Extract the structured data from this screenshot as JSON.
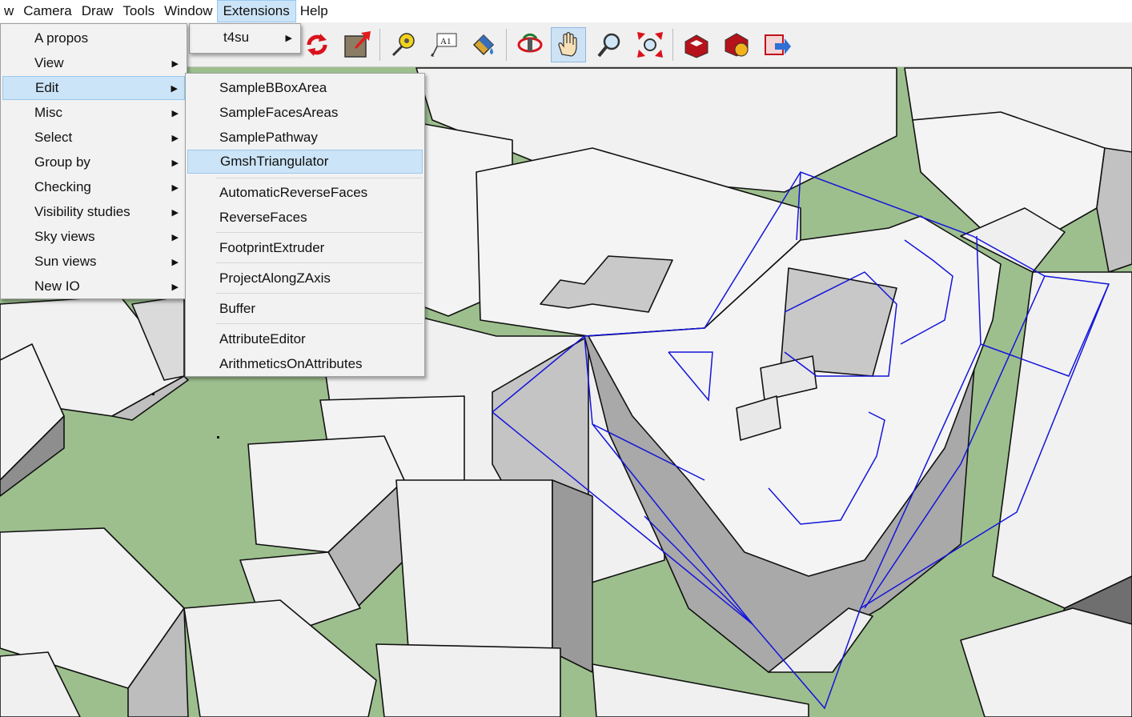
{
  "menubar": {
    "items": [
      "w",
      "Camera",
      "Draw",
      "Tools",
      "Window",
      "Extensions",
      "Help"
    ],
    "active": "Extensions"
  },
  "extensions_menu": {
    "items": [
      {
        "label": "t4su",
        "has_submenu": true
      }
    ]
  },
  "t4su_menu": {
    "items": [
      {
        "label": "A propos",
        "has_submenu": false
      },
      {
        "label": "View",
        "has_submenu": true
      },
      {
        "label": "Edit",
        "has_submenu": true,
        "highlighted": true
      },
      {
        "label": "Misc",
        "has_submenu": true
      },
      {
        "label": "Select",
        "has_submenu": true
      },
      {
        "label": "Group by",
        "has_submenu": true
      },
      {
        "label": "Checking",
        "has_submenu": true
      },
      {
        "label": "Visibility studies",
        "has_submenu": true
      },
      {
        "label": "Sky views",
        "has_submenu": true
      },
      {
        "label": "Sun views",
        "has_submenu": true
      },
      {
        "label": "New IO",
        "has_submenu": true
      }
    ]
  },
  "edit_menu": {
    "groups": [
      [
        "SampleBBoxArea",
        "SampleFacesAreas",
        "SamplePathway",
        "GmshTriangulator"
      ],
      [
        "AutomaticReverseFaces",
        "ReverseFaces"
      ],
      [
        "FootprintExtruder"
      ],
      [
        "ProjectAlongZAxis"
      ],
      [
        "Buffer"
      ],
      [
        "AttributeEditor",
        "ArithmeticsOnAttributes"
      ]
    ],
    "highlighted": "GmshTriangulator"
  },
  "toolbar": {
    "buttons": [
      {
        "icon": "refresh-icon",
        "pressed": false
      },
      {
        "icon": "scale-icon",
        "pressed": false
      },
      {
        "icon": "tape-measure-icon",
        "pressed": false
      },
      {
        "icon": "text-icon",
        "label": "A1",
        "pressed": false
      },
      {
        "icon": "paint-bucket-icon",
        "pressed": false
      },
      {
        "icon": "orbit-icon",
        "pressed": false
      },
      {
        "icon": "pan-icon",
        "pressed": true
      },
      {
        "icon": "zoom-icon",
        "pressed": false
      },
      {
        "icon": "zoom-extents-icon",
        "pressed": false
      },
      {
        "icon": "warehouse-icon",
        "pressed": false
      },
      {
        "icon": "extension-warehouse-icon",
        "pressed": false
      },
      {
        "icon": "send-to-layout-icon",
        "pressed": false
      }
    ]
  },
  "colors": {
    "ground": "#9dbf8e",
    "building_top": "#f3f3f3",
    "building_side": "#b9b9b9",
    "selection": "#1414dc",
    "menu_highlight": "#cce4f7"
  }
}
